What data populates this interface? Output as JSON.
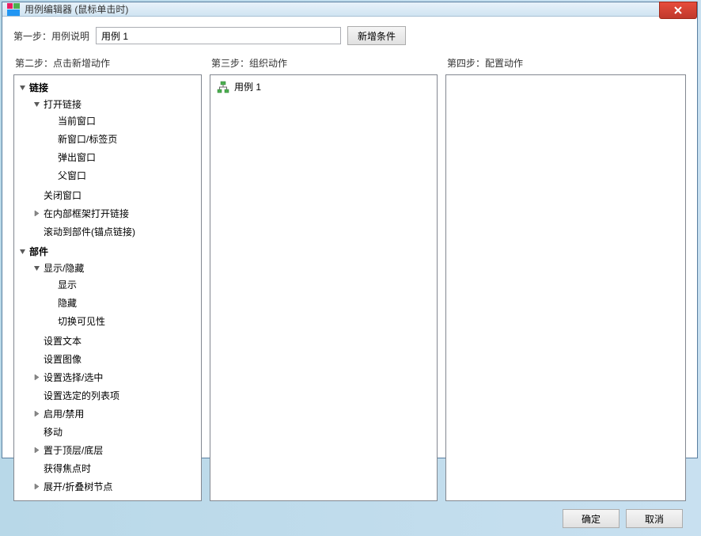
{
  "window": {
    "title": "用例编辑器 (鼠标单击时)"
  },
  "step1": {
    "label": "第一步：用例说明",
    "inputValue": "用例 1",
    "addConditionLabel": "新增条件"
  },
  "step2": {
    "label": "第二步：点击新增动作",
    "tree": {
      "link": {
        "label": "链接",
        "open": {
          "label": "打开链接",
          "currentWindow": "当前窗口",
          "newWindow": "新窗口/标签页",
          "popup": "弹出窗口",
          "parent": "父窗口"
        },
        "close": "关闭窗口",
        "iframe": "在内部框架打开链接",
        "scroll": "滚动到部件(锚点链接)"
      },
      "widget": {
        "label": "部件",
        "showHide": {
          "label": "显示/隐藏",
          "show": "显示",
          "hide": "隐藏",
          "toggle": "切换可见性"
        },
        "setText": "设置文本",
        "setImage": "设置图像",
        "setSelect": "设置选择/选中",
        "setListItem": "设置选定的列表项",
        "enableDisable": "启用/禁用",
        "move": "移动",
        "bringFront": "置于顶层/底层",
        "focus": "获得焦点时",
        "expandCollapse": "展开/折叠树节点"
      }
    }
  },
  "step3": {
    "label": "第三步：组织动作",
    "caseName": "用例 1"
  },
  "step4": {
    "label": "第四步：配置动作"
  },
  "footer": {
    "ok": "确定",
    "cancel": "取消"
  }
}
